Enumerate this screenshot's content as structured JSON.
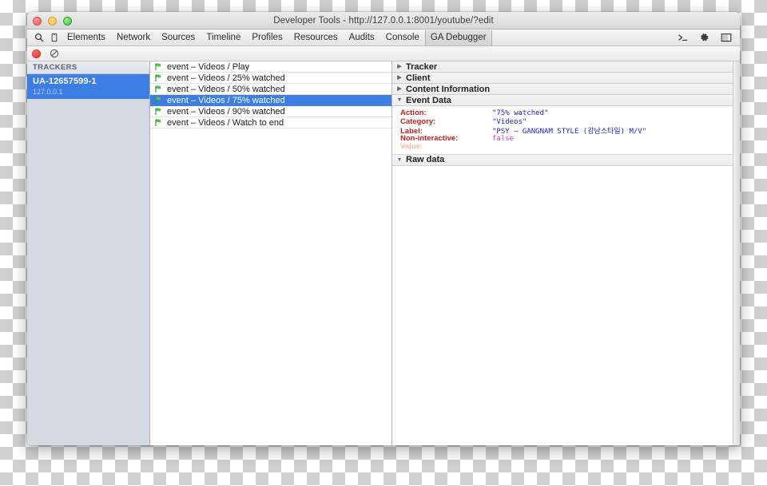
{
  "window": {
    "title": "Developer Tools - http://127.0.0.1:8001/youtube/?edit",
    "traffic_lights": [
      "close-button",
      "minimize-button",
      "maximize-button"
    ]
  },
  "toolbar": {
    "left_icons": [
      "search-icon",
      "device-mode-icon"
    ],
    "tabs": [
      {
        "label": "Elements",
        "active": false
      },
      {
        "label": "Network",
        "active": false
      },
      {
        "label": "Sources",
        "active": false
      },
      {
        "label": "Timeline",
        "active": false
      },
      {
        "label": "Profiles",
        "active": false
      },
      {
        "label": "Resources",
        "active": false
      },
      {
        "label": "Audits",
        "active": false
      },
      {
        "label": "Console",
        "active": false
      },
      {
        "label": "GA Debugger",
        "active": true
      }
    ],
    "right_icons": [
      "console-prompt-icon",
      "settings-gear-icon",
      "dock-layout-icon"
    ]
  },
  "sub_toolbar": {
    "record_label": "record-button",
    "clear_label": "clear-button"
  },
  "sidebar": {
    "header": "TRACKERS",
    "trackers": [
      {
        "id": "UA-12657599-1",
        "host": "127.0.0.1",
        "selected": true
      }
    ]
  },
  "hitlist": {
    "rows": [
      {
        "label": "event – Videos / Play",
        "selected": false
      },
      {
        "label": "event – Videos / 25% watched",
        "selected": false
      },
      {
        "label": "event – Videos / 50% watched",
        "selected": false
      },
      {
        "label": "event – Videos / 75% watched",
        "selected": true
      },
      {
        "label": "event – Videos / 90% watched",
        "selected": false
      },
      {
        "label": "event – Videos / Watch to end",
        "selected": false
      }
    ]
  },
  "detail": {
    "sections": [
      {
        "title": "Tracker",
        "expanded": false
      },
      {
        "title": "Client",
        "expanded": false
      },
      {
        "title": "Content Information",
        "expanded": false
      },
      {
        "title": "Event Data",
        "expanded": true
      },
      {
        "title": "Raw data",
        "expanded": true
      }
    ],
    "event_data": [
      {
        "key": "Action:",
        "value": "\"75% watched\"",
        "kind": "string",
        "muted": false
      },
      {
        "key": "Category:",
        "value": "\"Videos\"",
        "kind": "string",
        "muted": false
      },
      {
        "key": "Label:",
        "value": "\"PSY – GANGNAM STYLE (강남스타일) M/V\"",
        "kind": "string",
        "muted": false
      },
      {
        "key": "Non-interactive:",
        "value": "false",
        "kind": "bool",
        "muted": false
      },
      {
        "key": "Value:",
        "value": "",
        "kind": "string",
        "muted": true
      }
    ]
  },
  "colors": {
    "selection_blue": "#3c7ee4",
    "sidebar_bg": "#d4dae2",
    "key_red": "#c81e1e",
    "value_blue": "#2323cc",
    "bool_magenta": "#d33ad3"
  }
}
